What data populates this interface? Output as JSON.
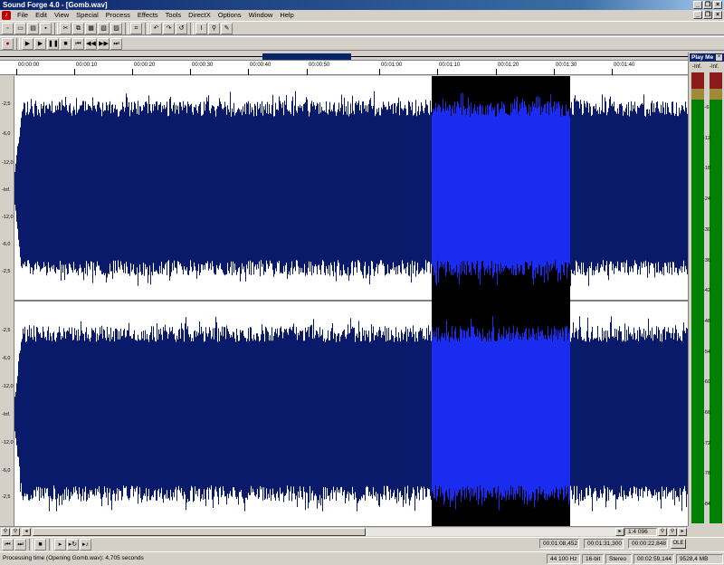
{
  "window": {
    "title": "Sound Forge 4.0 - [Gomb.wav]"
  },
  "menu": {
    "items": [
      "File",
      "Edit",
      "View",
      "Special",
      "Process",
      "Effects",
      "Tools",
      "DirectX",
      "Options",
      "Window",
      "Help"
    ]
  },
  "ruler": {
    "labels": [
      "00:00:00",
      "00:00:10",
      "00:00:20",
      "00:00:30",
      "00:00:40",
      "00:00:50",
      "00:01:00",
      "00:01:10",
      "00:01:20",
      "00:01:30",
      "00:01:40"
    ]
  },
  "waveform": {
    "channel_db_labels": [
      "-2,5",
      "-6,0",
      "-12,0",
      "-Inf.",
      "-12,0",
      "-6,0",
      "-2,5"
    ],
    "wave_color": "#0a1a6a",
    "selection_wave_color": "#1a2cf0",
    "selection_background": "#000000",
    "background": "#ffffff"
  },
  "zoom": {
    "ratio": "1:4 096"
  },
  "times": {
    "selection_start": "00:01:08,452",
    "selection_end": "00:01:31,300",
    "selection_length": "00:00:22,848",
    "ole_label": "OLE"
  },
  "status": {
    "message": "Processing time (Opening Gomb.wav): 4,705 seconds",
    "sample_rate": "44 100 Hz",
    "bit_depth": "16-bit",
    "channels": "Stereo",
    "total_length": "00:02:59,144",
    "free_space": "9528,4 MB"
  },
  "play_meter": {
    "title": "Play Me",
    "close_label": "×",
    "left_inf": "-Inf.",
    "right_inf": "-Inf.",
    "scale": [
      "-6",
      "-12",
      "-18",
      "-24",
      "-30",
      "-36",
      "-42",
      "-48",
      "-54",
      "-60",
      "-66",
      "-72",
      "-78",
      "-84"
    ]
  }
}
